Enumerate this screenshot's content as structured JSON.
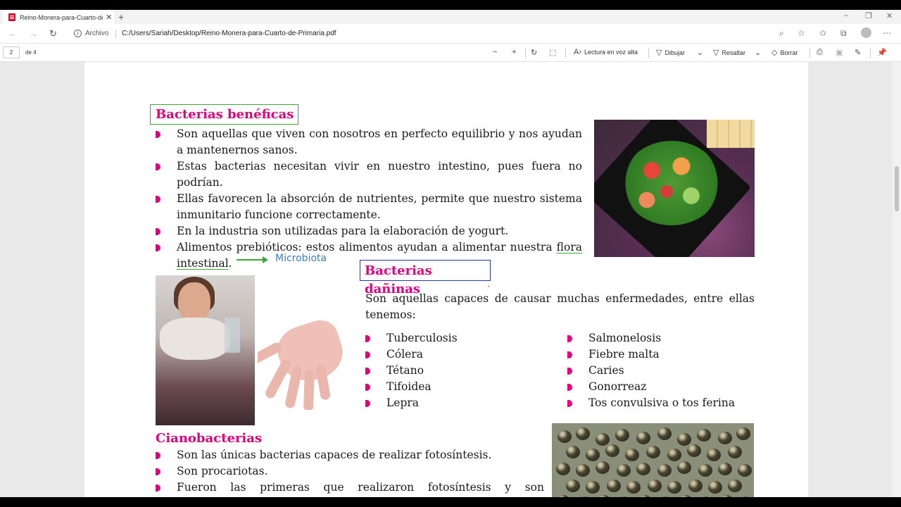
{
  "browser": {
    "tab_title": "Reino-Monera-para-Cuarto-de-P",
    "tab_close": "✕",
    "new_tab": "+",
    "site_label": "Archivo",
    "url": "C:/Users/Sariah/Desktop/Reino-Monera-para-Cuarto-de-Primaria.pdf",
    "window_controls": [
      "–",
      "❐",
      "✕"
    ]
  },
  "pdf_toolbar": {
    "page_number": "2",
    "page_total": "de 4",
    "read_aloud": "Lectura en voz alta",
    "draw": "Dibujar",
    "highlight": "Resaltar",
    "erase": "Borrar"
  },
  "document": {
    "beneficial": {
      "heading": "Bacterias benéficas",
      "items": [
        "Son aquellas que viven con nosotros en perfecto equilibrio y nos ayudan a mantenernos sanos.",
        "Estas bacterias necesitan vivir en nuestro intestino, pues fuera no podrían.",
        "Ellas favorecen la absorción de nutrientes, permite que nuestro sistema inmunitario funcione correctamente.",
        "En la industria son utilizadas para la elaboración de yogurt."
      ],
      "prebiotic_text": "Alimentos prebióticos: estos alimentos ayudan a alimentar nuestra",
      "prebiotic_underlined": "flora intestinal",
      "prebiotic_end": ".",
      "annotation": "Microbiota"
    },
    "harmful": {
      "heading": "Bacterias dañinas",
      "intro": "Son aquellas capaces de causar muchas enfermedades, entre ellas tenemos:",
      "diseases_left": [
        "Tuberculosis",
        "Cólera",
        "Tétano",
        "Tifoidea",
        "Lepra"
      ],
      "diseases_right": [
        "Salmonelosis",
        "Fiebre malta",
        "Caries",
        "Gonorreaz",
        "Tos convulsiva o tos ferina"
      ]
    },
    "cyano": {
      "heading": "Cianobacterias",
      "items": [
        "Son las únicas bacterias capaces de realizar fotosíntesis.",
        "Son procariotas.",
        "Fueron las primeras que realizaron fotosíntesis y son responsables de la aparición del oxígeno en la atmósfera."
      ]
    }
  },
  "colors": {
    "heading_magenta": "#e4007c",
    "box_green": "#39a935",
    "box_blue": "#2b3a9c",
    "annotation_blue": "#3b7dc4"
  }
}
